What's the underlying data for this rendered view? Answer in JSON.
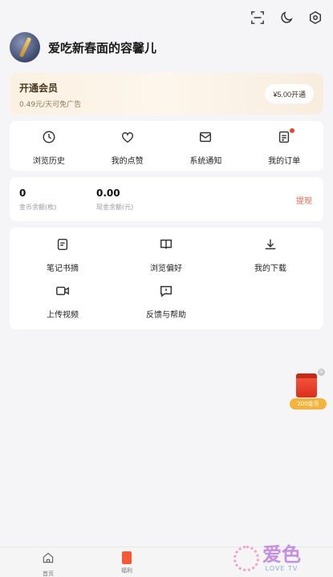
{
  "top_icons": [
    "scan-icon",
    "moon-icon",
    "settings-icon"
  ],
  "profile": {
    "username": "爱吃新春面的容馨儿"
  },
  "vip": {
    "title": "开通会员",
    "subtitle": "0.49元/天可免广告",
    "button": "¥5.00开通"
  },
  "quick_actions": [
    {
      "label": "浏览历史",
      "icon": "clock-icon"
    },
    {
      "label": "我的点赞",
      "icon": "heart-icon"
    },
    {
      "label": "系统通知",
      "icon": "mail-icon"
    },
    {
      "label": "我的订单",
      "icon": "order-icon",
      "badge": true
    }
  ],
  "wallet": {
    "coins": "0",
    "coins_label": "金币余额(枚)",
    "cash": "0.00",
    "cash_label": "现金余额(元)",
    "withdraw": "提现"
  },
  "features": [
    {
      "label": "笔记书摘",
      "icon": "note-icon"
    },
    {
      "label": "浏览偏好",
      "icon": "book-icon"
    },
    {
      "label": "我的下载",
      "icon": "download-icon"
    },
    {
      "label": "上传视频",
      "icon": "video-icon"
    },
    {
      "label": "反馈与帮助",
      "icon": "feedback-icon"
    }
  ],
  "red_packet": {
    "tag": "200金币"
  },
  "tabbar": [
    {
      "label": "首页",
      "icon": "home-icon"
    },
    {
      "label": "福利",
      "icon": "welfare-icon"
    }
  ],
  "watermark": {
    "cn": "爱色",
    "en": "LOVE TV"
  },
  "colors": {
    "accent_red": "#e8462c",
    "withdraw": "#e2684a",
    "vip_bg": "#fbf1e2",
    "badge_gold": "#f4b33a"
  }
}
